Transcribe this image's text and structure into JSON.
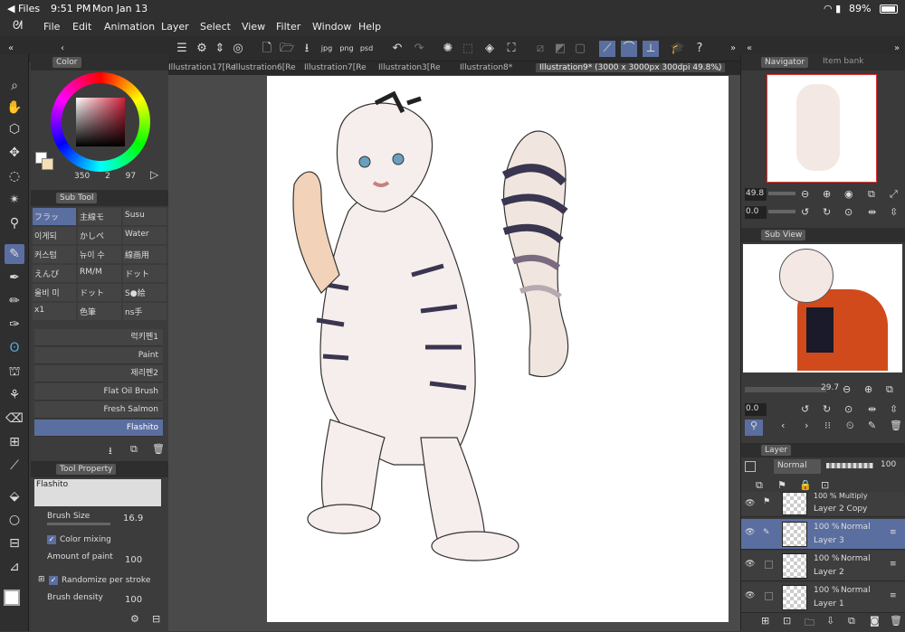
{
  "status": {
    "back": "◀ Files",
    "time": "9:51 PM",
    "date": "Mon Jan 13",
    "battery": "89%"
  },
  "menu": [
    "File",
    "Edit",
    "Animation",
    "Layer",
    "Select",
    "View",
    "Filter",
    "Window",
    "Help"
  ],
  "tabs": [
    "Illustration17[Re",
    "Illustration6[Re",
    "Illustration7[Re",
    "Illustration3[Re",
    "Illustration8*",
    "Illustration9* (3000 x 3000px 300dpi 49.8%)"
  ],
  "color_panel": {
    "title": "Color",
    "size": "350",
    "opacity_a": "2",
    "opacity_b": "97"
  },
  "subtool": {
    "title": "Sub Tool",
    "grid": [
      [
        "フラッ",
        "主線モ",
        "Susu"
      ],
      [
        "이게되",
        "かしペ",
        "Water"
      ],
      [
        "커스텀",
        "뉴이 수",
        "線画用"
      ],
      [
        "えんぴ",
        "RM/M",
        "ドット"
      ],
      [
        "올비 미",
        "ドット",
        "S●絵"
      ],
      [
        "x1",
        "色筆",
        "ns手"
      ]
    ],
    "brushes": [
      "럭키펜1",
      "Paint",
      "제리펜2",
      "Flat Oil Brush",
      "Fresh Salmon",
      "Flashito"
    ]
  },
  "tool_property": {
    "title": "Tool Property",
    "brush_name": "Flashito",
    "brush_size_label": "Brush Size",
    "brush_size": "16.9",
    "color_mixing": "Color mixing",
    "amount_label": "Amount of paint",
    "amount": "100",
    "randomize": "Randomize per stroke",
    "density_label": "Brush density",
    "density": "100"
  },
  "navigator": {
    "title": "Navigator",
    "tab2": "Item bank",
    "zoom": "49.8",
    "angle": "0.0"
  },
  "subview": {
    "title": "Sub View",
    "zoom": "29.7",
    "angle": "0.0"
  },
  "layer_panel": {
    "title": "Layer",
    "blend": "Normal",
    "opacity": "100",
    "layers": [
      {
        "pct": "100 % Multiply",
        "name": "Layer 2 Copy"
      },
      {
        "pct": "100 %",
        "mode": "Normal",
        "name": "Layer 3"
      },
      {
        "pct": "100 %",
        "mode": "Normal",
        "name": "Layer 2"
      },
      {
        "pct": "100 %",
        "mode": "Normal",
        "name": "Layer 1"
      }
    ]
  }
}
